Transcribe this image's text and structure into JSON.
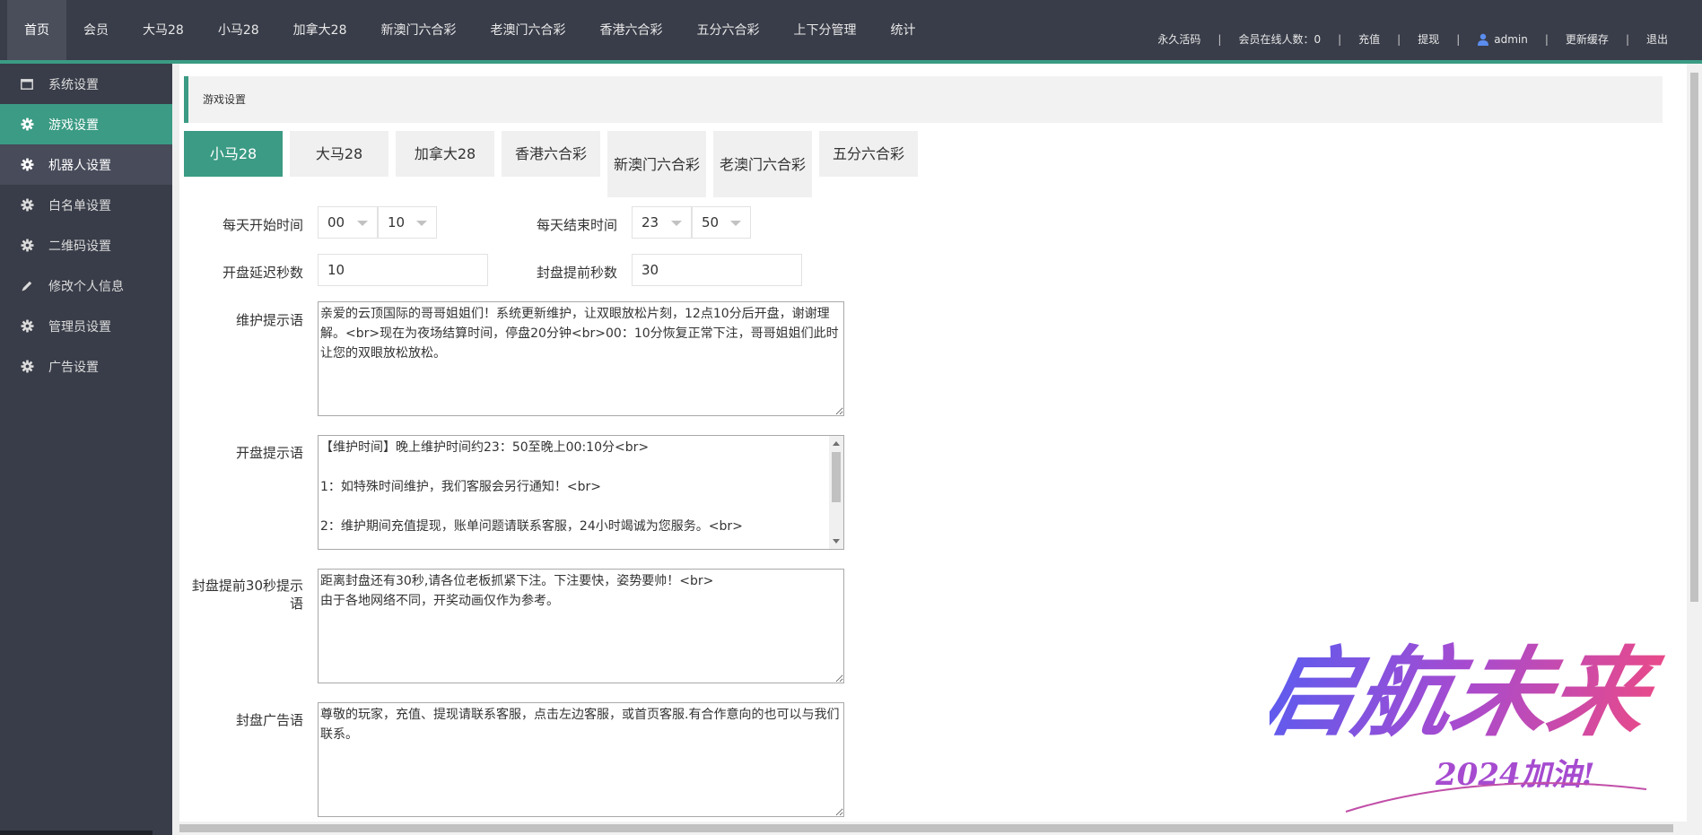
{
  "top_nav": [
    {
      "label": "首页",
      "active": true
    },
    {
      "label": "会员"
    },
    {
      "label": "大马28"
    },
    {
      "label": "小马28"
    },
    {
      "label": "加拿大28"
    },
    {
      "label": "新澳门六合彩"
    },
    {
      "label": "老澳门六合彩"
    },
    {
      "label": "香港六合彩"
    },
    {
      "label": "五分六合彩"
    },
    {
      "label": "上下分管理"
    },
    {
      "label": "统计"
    }
  ],
  "top_right": {
    "permanent_code": "永久活码",
    "online_members": "会员在线人数：0",
    "recharge": "充值",
    "withdraw": "提现",
    "user": "admin",
    "refresh_cache": "更新缓存",
    "logout": "退出",
    "separator": "|"
  },
  "sidebar": {
    "items": [
      {
        "label": "系统设置",
        "icon": "window-icon"
      },
      {
        "label": "游戏设置",
        "icon": "gear-icon",
        "active": true
      },
      {
        "label": "机器人设置",
        "icon": "gear-icon",
        "hover": true
      },
      {
        "label": "白名单设置",
        "icon": "gear-icon"
      },
      {
        "label": "二维码设置",
        "icon": "gear-icon"
      },
      {
        "label": "修改个人信息",
        "icon": "pencil-icon"
      },
      {
        "label": "管理员设置",
        "icon": "gear-icon"
      },
      {
        "label": "广告设置",
        "icon": "gear-icon"
      }
    ]
  },
  "breadcrumb": "游戏设置",
  "game_tabs": [
    {
      "label": "小马28",
      "active": true
    },
    {
      "label": "大马28"
    },
    {
      "label": "加拿大28"
    },
    {
      "label": "香港六合彩"
    },
    {
      "label": "新澳门六合彩"
    },
    {
      "label": "老澳门六合彩"
    },
    {
      "label": "五分六合彩"
    }
  ],
  "form": {
    "start_time": {
      "label": "每天开始时间",
      "hour": "00",
      "minute": "10"
    },
    "end_time": {
      "label": "每天结束时间",
      "hour": "23",
      "minute": "50"
    },
    "open_delay": {
      "label": "开盘延迟秒数",
      "value": "10"
    },
    "close_before": {
      "label": "封盘提前秒数",
      "value": "30"
    },
    "maintenance_tip": {
      "label": "维护提示语",
      "value": "亲爱的云顶国际的哥哥姐姐们！系统更新维护，让双眼放松片刻，12点10分后开盘，谢谢理解。<br>现在为夜场结算时间，停盘20分钟<br>00：10分恢复正常下注，哥哥姐姐们此时让您的双眼放松放松。"
    },
    "open_tip": {
      "label": "开盘提示语",
      "value": "【维护时间】晚上维护时间约23：50至晚上00:10分<br>\n\n1：如特殊时间维护，我们客服会另行通知！<br>\n\n2：维护期间充值提现，账单问题请联系客服，24小时竭诚为您服务。<br>"
    },
    "close30_tip": {
      "label": "封盘提前30秒提示语",
      "value": "距离封盘还有30秒,请各位老板抓紧下注。下注要快，姿势要帅！<br>\n由于各地网络不同，开奖动画仅作为参考。"
    },
    "close_ad": {
      "label": "封盘广告语",
      "value": "尊敬的玩家，充值、提现请联系客服，点击左边客服，或首页客服.有合作意向的也可以与我们联系。"
    }
  },
  "watermark": {
    "main": "启航未来",
    "sub": "2024加油!"
  },
  "colors": {
    "accent": "#3b9b84",
    "topbar": "#393d49",
    "sidebar": "#393d49"
  }
}
